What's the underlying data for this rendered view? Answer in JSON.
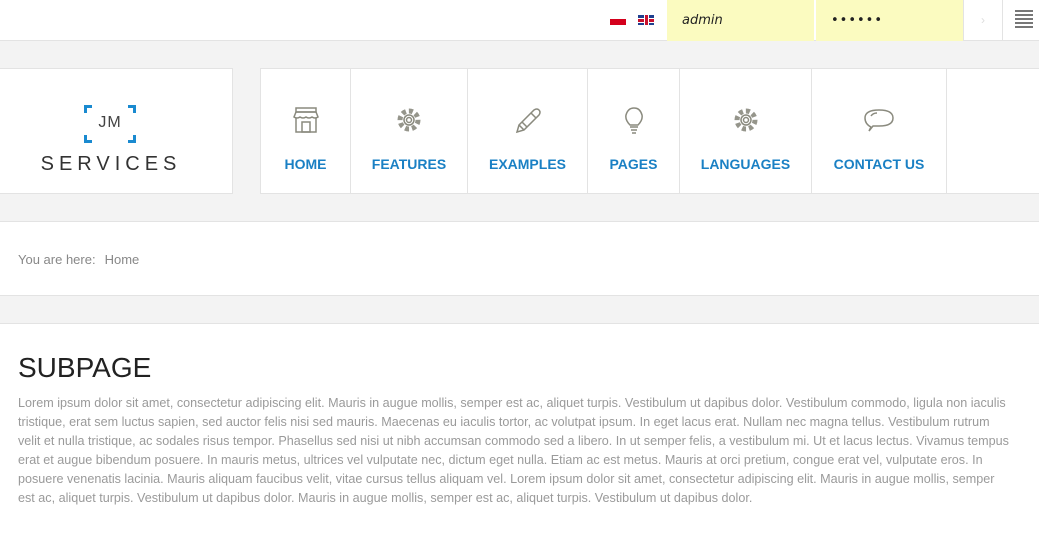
{
  "topbar": {
    "languages": [
      {
        "name": "Polish",
        "icon": "flag-pl-icon"
      },
      {
        "name": "English",
        "icon": "flag-en-icon"
      }
    ],
    "username_value": "admin",
    "password_value": "••••••",
    "submit_icon": "chevron-right-icon",
    "menu_icon": "hamburger-icon"
  },
  "logo": {
    "mark": "JM",
    "name": "SERVICES",
    "accent": "#1a8ad0"
  },
  "nav": {
    "items": [
      {
        "label": "HOME",
        "icon": "store-icon"
      },
      {
        "label": "FEATURES",
        "icon": "gear-icon"
      },
      {
        "label": "EXAMPLES",
        "icon": "pencil-icon"
      },
      {
        "label": "PAGES",
        "icon": "lightbulb-icon"
      },
      {
        "label": "LANGUAGES",
        "icon": "gear-icon"
      },
      {
        "label": "CONTACT US",
        "icon": "speech-bubble-icon"
      }
    ],
    "link_color": "#1a80c4"
  },
  "breadcrumb": {
    "prefix": "You are here:",
    "current": "Home"
  },
  "main": {
    "title": "SUBPAGE",
    "body": "Lorem ipsum dolor sit amet, consectetur adipiscing elit. Mauris in augue mollis, semper est ac, aliquet turpis. Vestibulum ut dapibus dolor. Vestibulum commodo, ligula non iaculis tristique, erat sem luctus sapien, sed auctor felis nisi sed mauris. Maecenas eu iaculis tortor, ac volutpat ipsum. In eget lacus erat. Nullam nec magna tellus. Vestibulum rutrum velit et nulla tristique, ac sodales risus tempor. Phasellus sed nisi ut nibh accumsan commodo sed a libero. In ut semper felis, a vestibulum mi. Ut et lacus lectus. Vivamus tempus erat et augue bibendum posuere. In mauris metus, ultrices vel vulputate nec, dictum eget nulla. Etiam ac est metus. Mauris at orci pretium, congue erat vel, vulputate eros. In posuere venenatis lacinia. Mauris aliquam faucibus velit, vitae cursus tellus aliquam vel. Lorem ipsum dolor sit amet, consectetur adipiscing elit. Mauris in augue mollis, semper est ac, aliquet turpis. Vestibulum ut dapibus dolor. Mauris in augue mollis, semper est ac, aliquet turpis. Vestibulum ut dapibus dolor."
  }
}
